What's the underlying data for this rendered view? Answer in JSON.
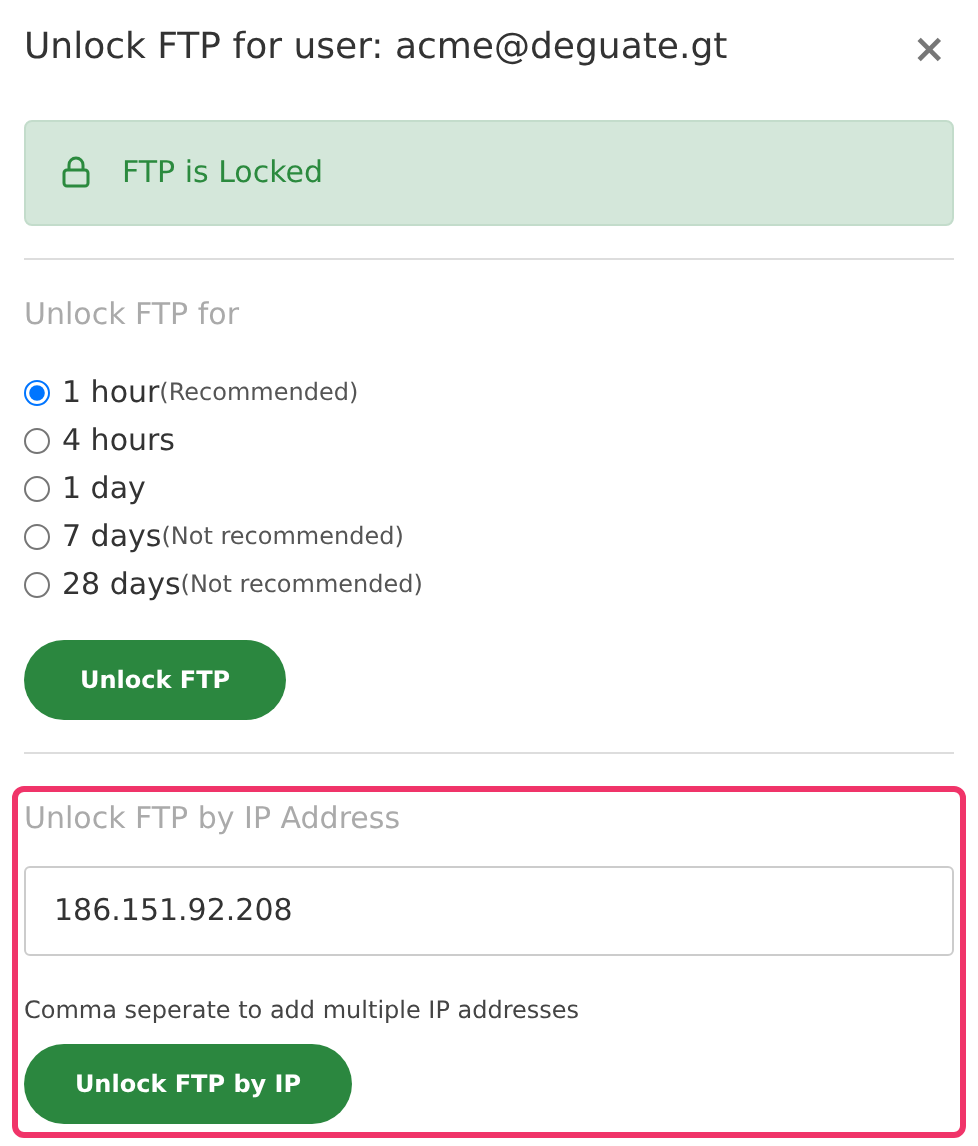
{
  "title": "Unlock FTP for user: acme@deguate.gt",
  "close": "×",
  "alert": {
    "text": "FTP is Locked"
  },
  "duration": {
    "heading": "Unlock FTP for",
    "options": [
      {
        "label": "1 hour",
        "note": "(Recommended)",
        "selected": true
      },
      {
        "label": "4 hours",
        "selected": false
      },
      {
        "label": "1 day",
        "selected": false
      },
      {
        "label": "7 days",
        "note": "(Not recommended)",
        "selected": false
      },
      {
        "label": "28 days",
        "note": "(Not recommended)",
        "selected": false
      }
    ],
    "button": "Unlock FTP"
  },
  "ip": {
    "heading": "Unlock FTP by IP Address",
    "value": "186.151.92.208",
    "help": "Comma seperate to add multiple IP addresses",
    "button": "Unlock FTP by IP",
    "highlighted": true
  }
}
